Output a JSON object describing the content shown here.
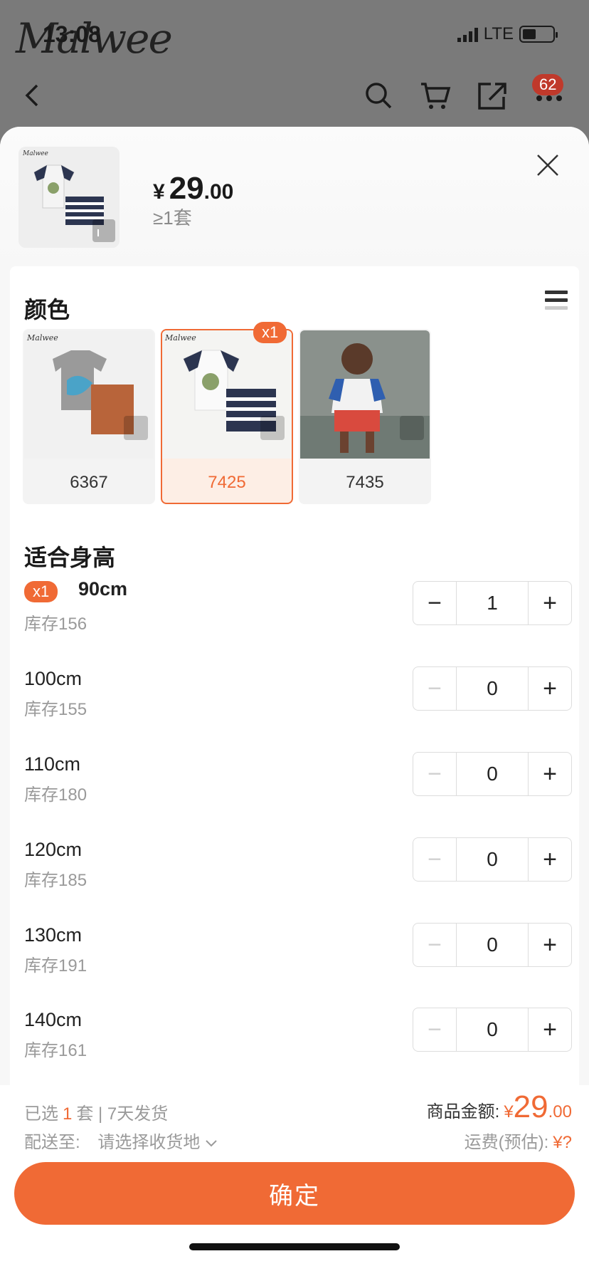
{
  "status_bar": {
    "time": "13:08",
    "network": "LTE",
    "logo_text": "Malwee"
  },
  "nav": {
    "cart_badge": "62"
  },
  "header": {
    "currency": "¥",
    "price_int": "29",
    "price_dec": ".00",
    "moq": "≥1套"
  },
  "color_section": {
    "title": "颜色",
    "swatches": [
      {
        "label": "6367",
        "selected": false,
        "qty": ""
      },
      {
        "label": "7425",
        "selected": true,
        "qty": "x1"
      },
      {
        "label": "7435",
        "selected": false,
        "qty": ""
      }
    ]
  },
  "size_section": {
    "title": "适合身高",
    "rows": [
      {
        "badge": "x1",
        "size": "90cm",
        "stock": "库存156",
        "qty": "1",
        "minus": "−",
        "plus": "+"
      },
      {
        "size": "100cm",
        "stock": "库存155",
        "qty": "0",
        "minus": "−",
        "plus": "+"
      },
      {
        "size": "110cm",
        "stock": "库存180",
        "qty": "0",
        "minus": "−",
        "plus": "+"
      },
      {
        "size": "120cm",
        "stock": "库存185",
        "qty": "0",
        "minus": "−",
        "plus": "+"
      },
      {
        "size": "130cm",
        "stock": "库存191",
        "qty": "0",
        "minus": "−",
        "plus": "+"
      },
      {
        "size": "140cm",
        "stock": "库存161",
        "qty": "0",
        "minus": "−",
        "plus": "+"
      }
    ]
  },
  "footer": {
    "selected_prefix": "已选",
    "selected_count": "1",
    "selected_suffix": "套 | 7天发货",
    "ship_to_label": "配送至:",
    "ship_to_value": "请选择收货地",
    "amount_label": "商品金额:",
    "amount_currency": "¥",
    "amount_int": "29",
    "amount_dec": ".00",
    "freight_label": "运费(预估):",
    "freight_value": "¥?",
    "confirm_label": "确定"
  },
  "colors": {
    "accent": "#f06a35",
    "badge_red": "#c0392b"
  }
}
